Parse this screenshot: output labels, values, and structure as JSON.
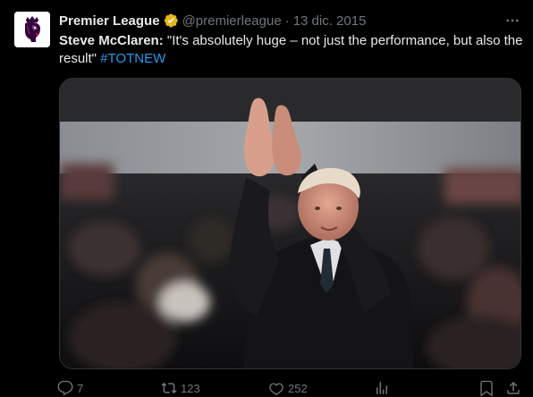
{
  "tweet": {
    "author_name": "Premier League",
    "handle": "@premierleague",
    "separator": "·",
    "date": "13 dic. 2015",
    "text_lead": "Steve McClaren:",
    "text_body": " \"It's absolutely huge – not just the performance, but also the result\" ",
    "hashtag": "#TOTNEW"
  },
  "icons": {
    "avatar": "premier-league-lion-logo",
    "verified": "gold-verified-badge",
    "more": "more-icon",
    "reply": "reply-icon",
    "retweet": "retweet-icon",
    "like": "like-icon",
    "views": "views-icon",
    "bookmark": "bookmark-icon",
    "share": "share-icon"
  },
  "colors": {
    "background": "#000000",
    "text": "#e7e9ea",
    "muted": "#71767b",
    "link": "#1d9bf0",
    "verified_gold": "#e2b719",
    "brand_purple": "#37003c"
  },
  "actions": {
    "replies": "7",
    "retweets": "123",
    "likes": "252"
  }
}
